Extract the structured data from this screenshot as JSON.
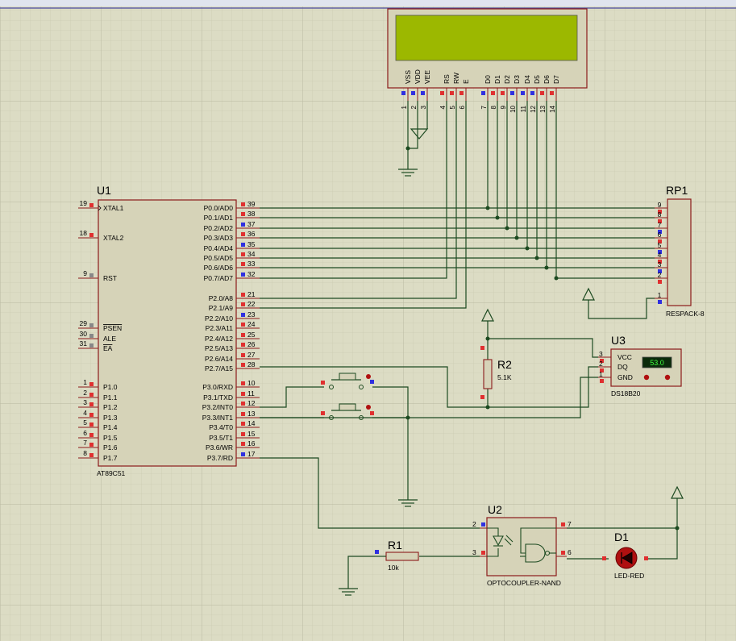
{
  "u1": {
    "ref": "U1",
    "part": "AT89C51",
    "left_pins": [
      {
        "num": "19",
        "name": "XTAL1"
      },
      {
        "num": "18",
        "name": "XTAL2"
      },
      {
        "num": "9",
        "name": "RST"
      },
      {
        "num": "29",
        "name": "PSEN"
      },
      {
        "num": "30",
        "name": "ALE"
      },
      {
        "num": "31",
        "name": "EA"
      },
      {
        "num": "1",
        "name": "P1.0"
      },
      {
        "num": "2",
        "name": "P1.1"
      },
      {
        "num": "3",
        "name": "P1.2"
      },
      {
        "num": "4",
        "name": "P1.3"
      },
      {
        "num": "5",
        "name": "P1.4"
      },
      {
        "num": "6",
        "name": "P1.5"
      },
      {
        "num": "7",
        "name": "P1.6"
      },
      {
        "num": "8",
        "name": "P1.7"
      }
    ],
    "right_pins": [
      {
        "num": "39",
        "name": "P0.0/AD0"
      },
      {
        "num": "38",
        "name": "P0.1/AD1"
      },
      {
        "num": "37",
        "name": "P0.2/AD2"
      },
      {
        "num": "36",
        "name": "P0.3/AD3"
      },
      {
        "num": "35",
        "name": "P0.4/AD4"
      },
      {
        "num": "34",
        "name": "P0.5/AD5"
      },
      {
        "num": "33",
        "name": "P0.6/AD6"
      },
      {
        "num": "32",
        "name": "P0.7/AD7"
      },
      {
        "num": "21",
        "name": "P2.0/A8"
      },
      {
        "num": "22",
        "name": "P2.1/A9"
      },
      {
        "num": "23",
        "name": "P2.2/A10"
      },
      {
        "num": "24",
        "name": "P2.3/A11"
      },
      {
        "num": "25",
        "name": "P2.4/A12"
      },
      {
        "num": "26",
        "name": "P2.5/A13"
      },
      {
        "num": "27",
        "name": "P2.6/A14"
      },
      {
        "num": "28",
        "name": "P2.7/A15"
      },
      {
        "num": "10",
        "name": "P3.0/RXD"
      },
      {
        "num": "11",
        "name": "P3.1/TXD"
      },
      {
        "num": "12",
        "name": "P3.2/INT0"
      },
      {
        "num": "13",
        "name": "P3.3/INT1"
      },
      {
        "num": "14",
        "name": "P3.4/T0"
      },
      {
        "num": "15",
        "name": "P3.5/T1"
      },
      {
        "num": "16",
        "name": "P3.6/WR"
      },
      {
        "num": "17",
        "name": "P3.7/RD"
      }
    ]
  },
  "lcd": {
    "pins": [
      {
        "num": "1",
        "name": "VSS"
      },
      {
        "num": "2",
        "name": "VDD"
      },
      {
        "num": "3",
        "name": "VEE"
      },
      {
        "num": "4",
        "name": "RS"
      },
      {
        "num": "5",
        "name": "RW"
      },
      {
        "num": "6",
        "name": "E"
      },
      {
        "num": "7",
        "name": "D0"
      },
      {
        "num": "8",
        "name": "D1"
      },
      {
        "num": "9",
        "name": "D2"
      },
      {
        "num": "10",
        "name": "D3"
      },
      {
        "num": "11",
        "name": "D4"
      },
      {
        "num": "12",
        "name": "D5"
      },
      {
        "num": "13",
        "name": "D6"
      },
      {
        "num": "14",
        "name": "D7"
      }
    ],
    "screen_color": "#9cb800"
  },
  "rp1": {
    "ref": "RP1",
    "part": "RESPACK-8",
    "pins": [
      "9",
      "8",
      "7",
      "6",
      "5",
      "4",
      "3",
      "2",
      "1"
    ]
  },
  "u3": {
    "ref": "U3",
    "part": "DS18B20",
    "pins": [
      {
        "num": "3",
        "name": "VCC"
      },
      {
        "num": "2",
        "name": "DQ"
      },
      {
        "num": "1",
        "name": "GND"
      }
    ],
    "display": "53.0"
  },
  "r2": {
    "ref": "R2",
    "value": "5.1K"
  },
  "r1": {
    "ref": "R1",
    "value": "10k"
  },
  "u2": {
    "ref": "U2",
    "part": "OPTOCOUPLER-NAND",
    "pins": [
      "2",
      "7",
      "3",
      "6"
    ]
  },
  "d1": {
    "ref": "D1",
    "part": "LED-RED"
  },
  "colors": {
    "background": "#dcdcc4",
    "grid": "#c4c4ac",
    "component_body": "#d6d3b8",
    "component_outline": "#8b1a1a",
    "wire": "#1c4a20",
    "pin_red": "#e03030",
    "pin_blue": "#3030e0",
    "led": "#b01010"
  }
}
